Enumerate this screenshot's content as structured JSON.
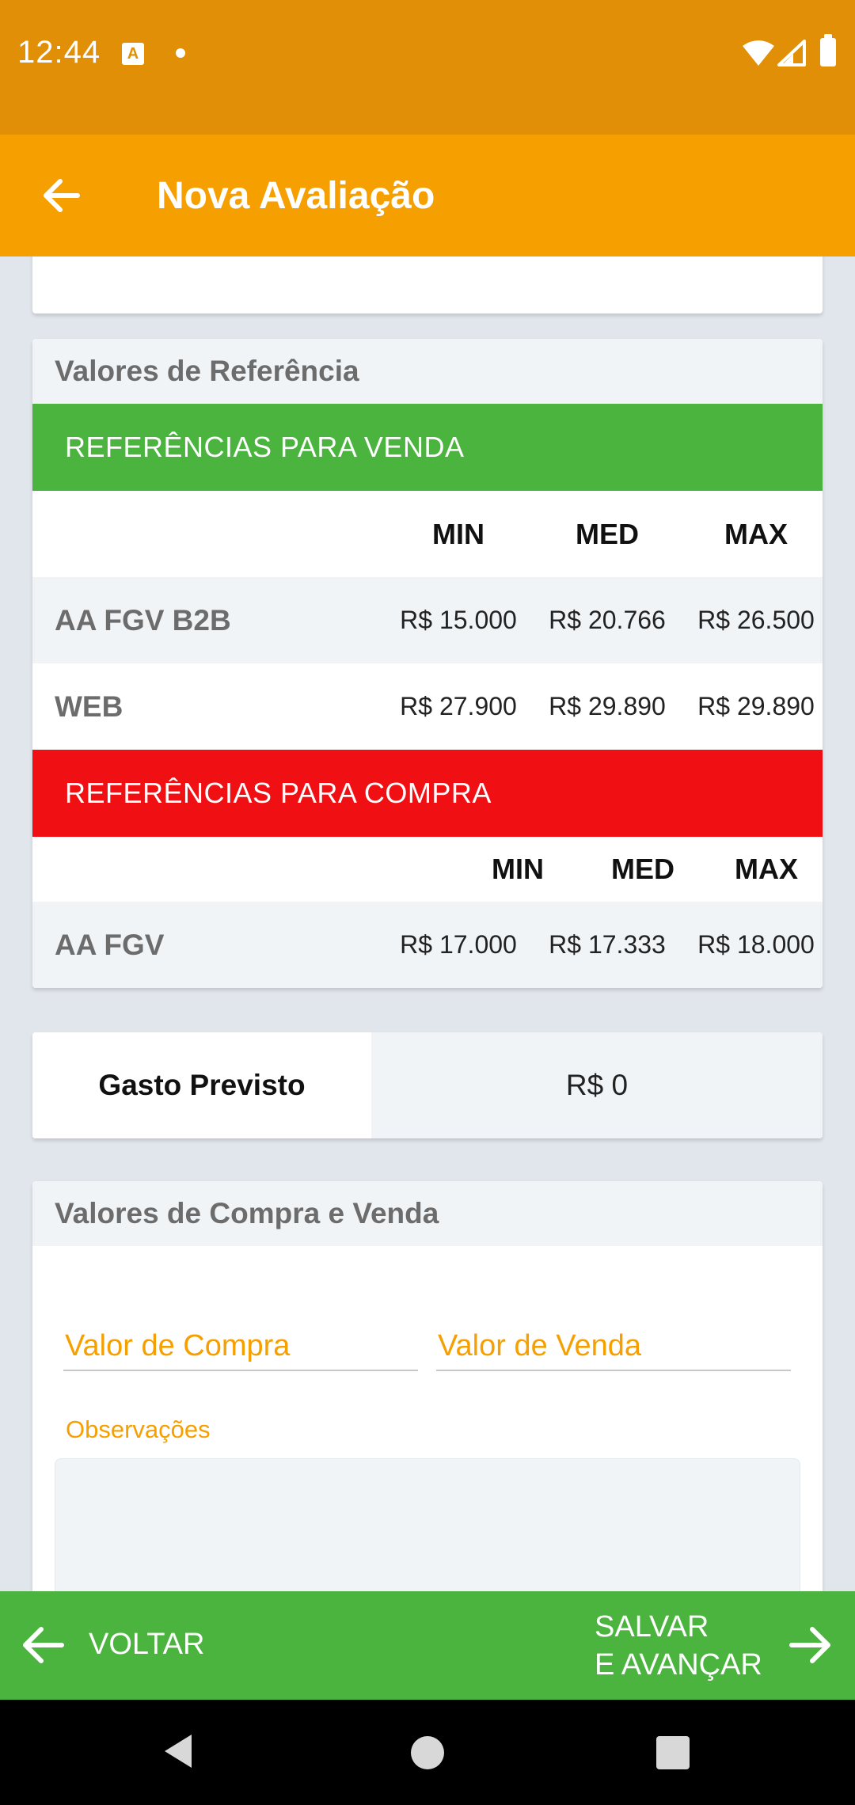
{
  "status_bar": {
    "time": "12:44",
    "notif_icon_letter": "A"
  },
  "app_bar": {
    "title": "Nova Avaliação"
  },
  "referencias": {
    "header": "Valores de Referência",
    "venda": {
      "banner": "REFERÊNCIAS PARA VENDA",
      "columns": [
        "MIN",
        "MED",
        "MAX"
      ],
      "rows": [
        {
          "label": "AA FGV B2B",
          "values": [
            "R$  15.000",
            "R$  20.766",
            "R$  26.500"
          ]
        },
        {
          "label": "WEB",
          "values": [
            "R$  27.900",
            "R$  29.890",
            "R$  29.890"
          ]
        }
      ]
    },
    "compra": {
      "banner": "REFERÊNCIAS PARA COMPRA",
      "columns": [
        "MIN",
        "MED",
        "MAX"
      ],
      "rows": [
        {
          "label": "AA FGV",
          "values": [
            "R$  17.000",
            "R$  17.333",
            "R$  18.000"
          ]
        }
      ]
    },
    "colors": {
      "venda": "#4bb43f",
      "compra": "#f00f12"
    }
  },
  "gasto": {
    "label": "Gasto Previsto",
    "value": "R$  0"
  },
  "compra_venda": {
    "header": "Valores de Compra e Venda",
    "compra_placeholder": "Valor de Compra",
    "venda_placeholder": "Valor de Venda",
    "obs_label": "Observações"
  },
  "bottom_bar": {
    "voltar": "VOLTAR",
    "salvar_line1": "SALVAR",
    "salvar_line2": "E AVANÇAR"
  },
  "theme": {
    "primary": "#f5a000",
    "status": "#e08f06",
    "accent_green": "#4bb43f"
  },
  "icons": [
    "wifi-icon",
    "signal-icon",
    "battery-icon",
    "back-arrow-icon",
    "arrow-left-icon",
    "arrow-right-icon",
    "nav-back-icon",
    "nav-home-icon",
    "nav-recent-icon"
  ]
}
